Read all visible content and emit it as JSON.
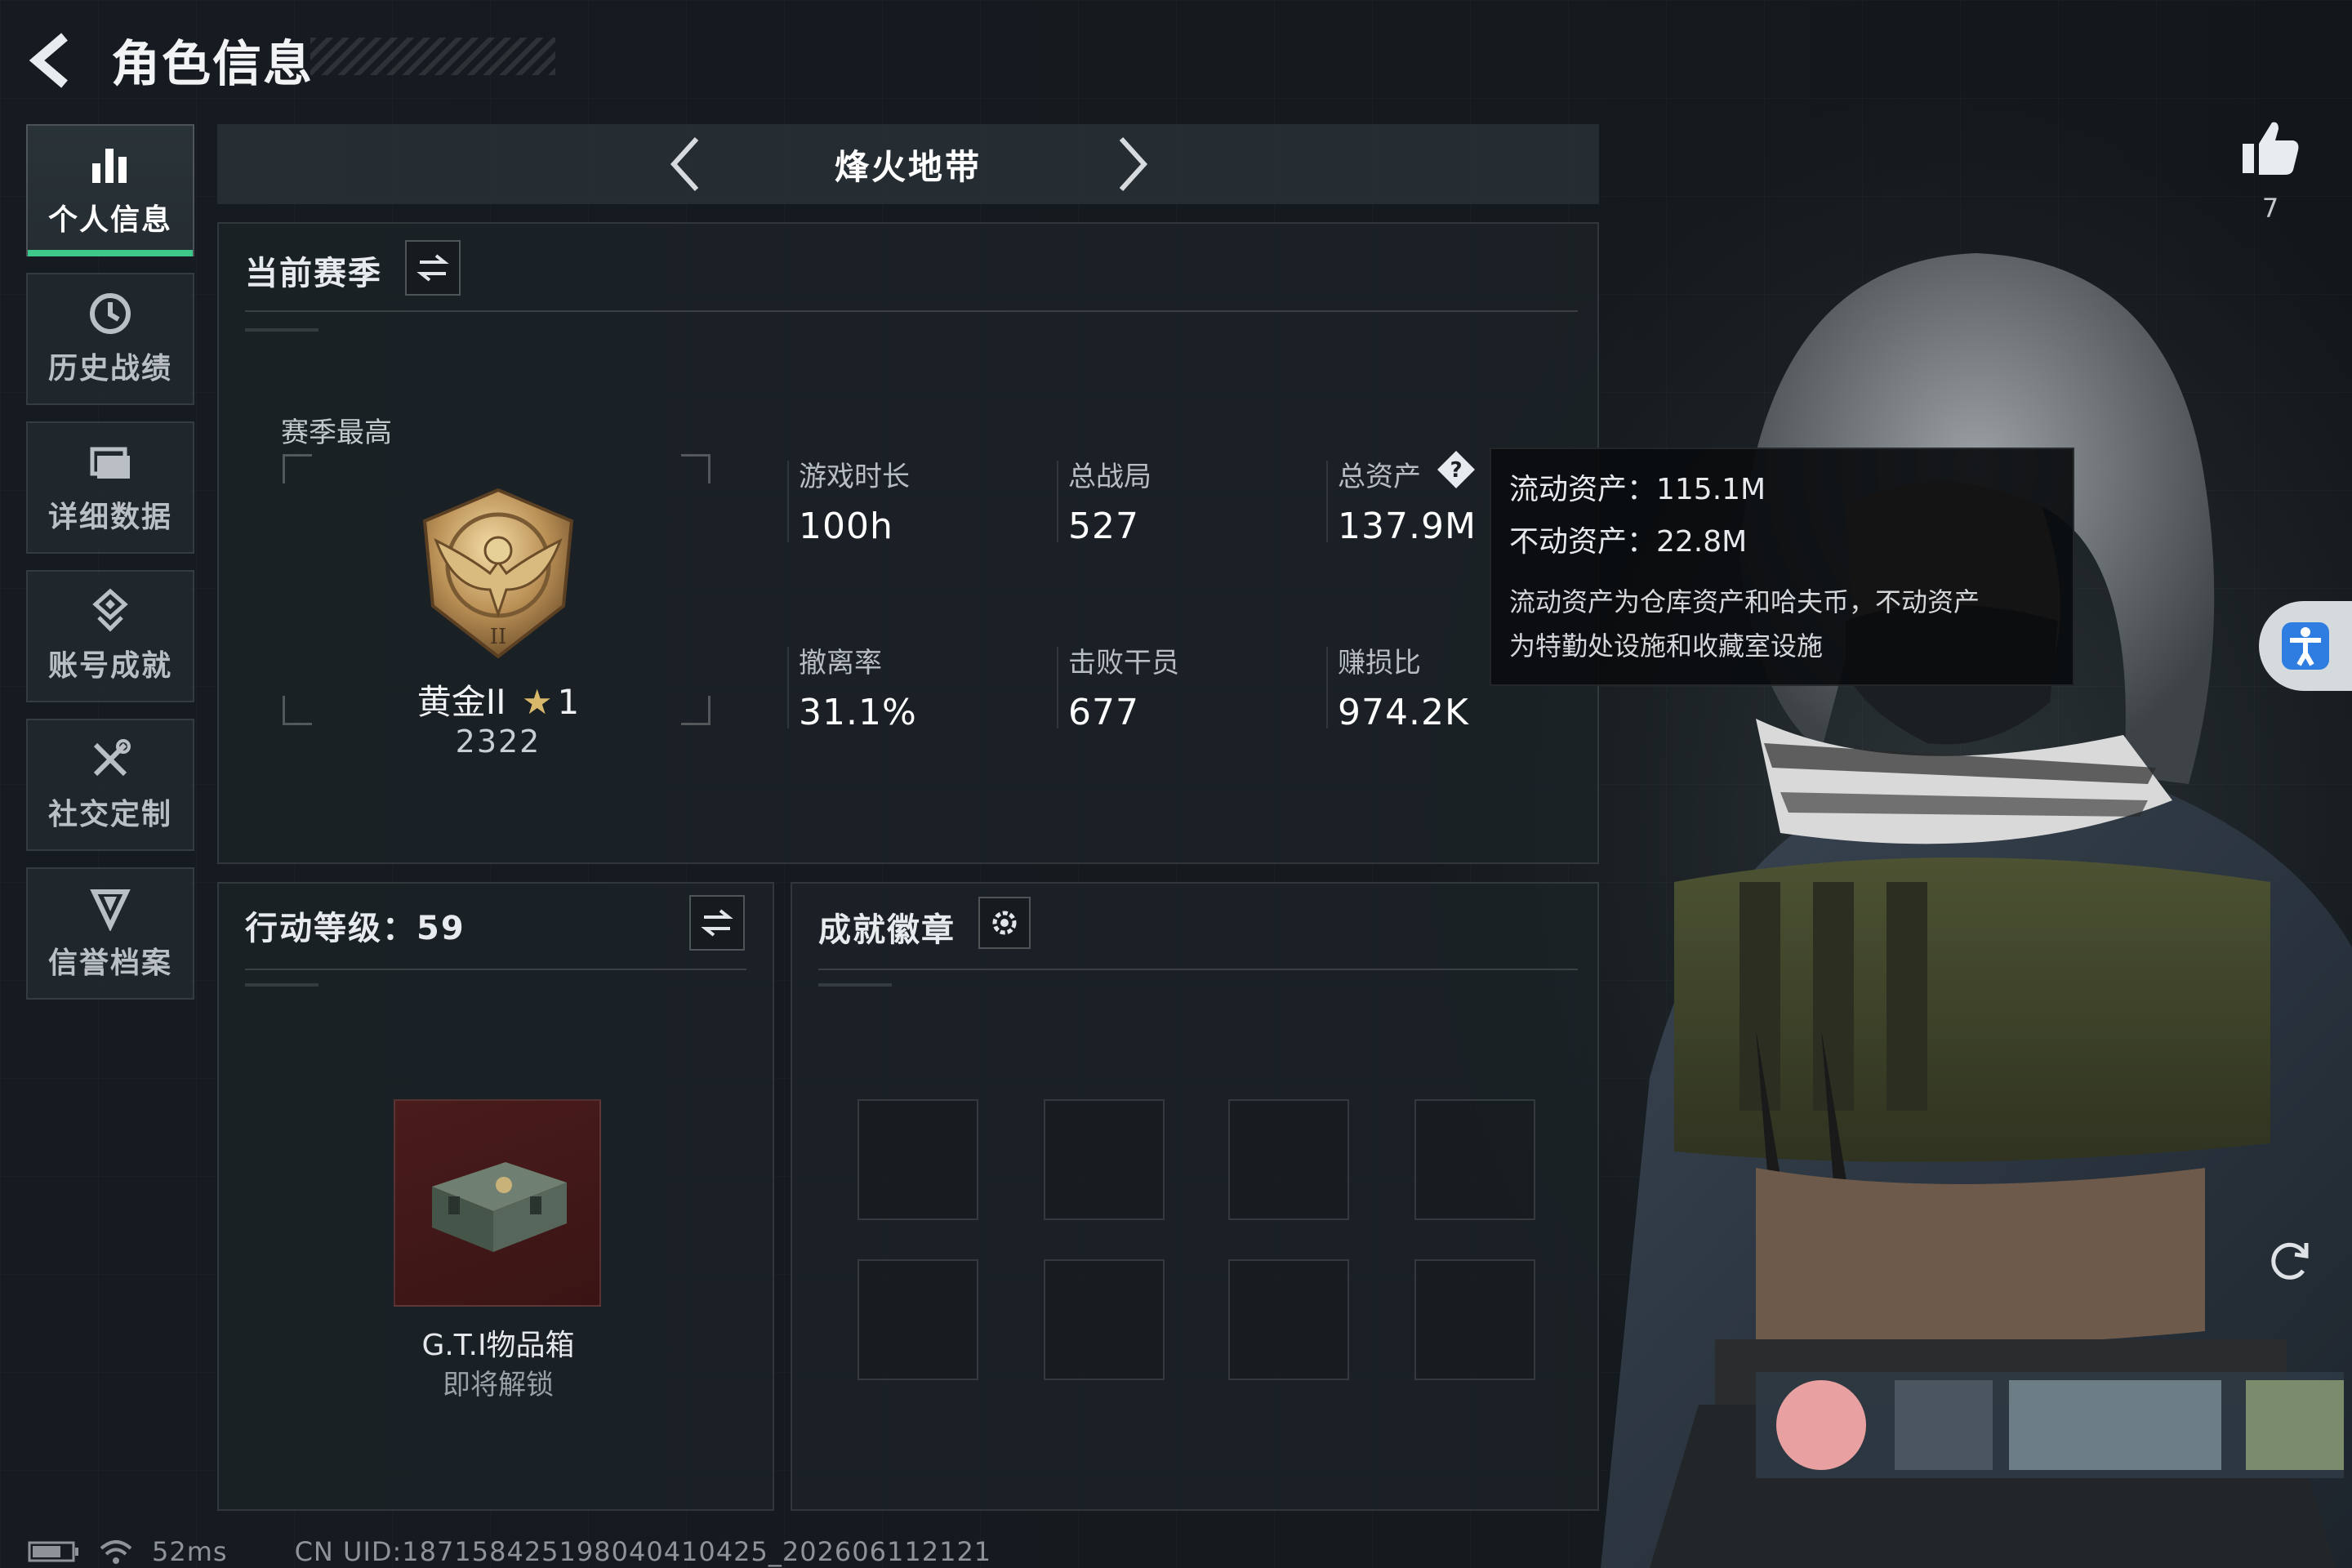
{
  "header": {
    "title": "角色信息"
  },
  "sidebar": {
    "items": [
      {
        "label": "个人信息",
        "icon": "bar-chart-icon",
        "active": true
      },
      {
        "label": "历史战绩",
        "icon": "history-icon",
        "active": false
      },
      {
        "label": "详细数据",
        "icon": "folder-icon",
        "active": false
      },
      {
        "label": "账号成就",
        "icon": "achievement-icon",
        "active": false
      },
      {
        "label": "社交定制",
        "icon": "tools-icon",
        "active": false
      },
      {
        "label": "信誉档案",
        "icon": "shield-icon",
        "active": false
      }
    ]
  },
  "mode": {
    "title": "烽火地带"
  },
  "season": {
    "title": "当前赛季",
    "best_label": "赛季最高",
    "rank_name": "黄金II",
    "rank_stars": "1",
    "rank_score": "2322",
    "stats": [
      {
        "label": "游戏时长",
        "value": "100h"
      },
      {
        "label": "总战局",
        "value": "527"
      },
      {
        "label": "总资产",
        "value": "137.9M"
      },
      {
        "label": "撤离率",
        "value": "31.1%"
      },
      {
        "label": "击败干员",
        "value": "677"
      },
      {
        "label": "赚损比",
        "value": "974.2K"
      }
    ]
  },
  "tooltip": {
    "liquid": "流动资产：115.1M",
    "fixed": "不动资产：22.8M",
    "desc_line1": "流动资产为仓库资产和哈夫币，不动资产",
    "desc_line2": "为特勤处设施和收藏室设施"
  },
  "action_level": {
    "title": "行动等级：59",
    "reward_name": "G.T.I物品箱",
    "reward_status": "即将解锁"
  },
  "badges": {
    "title": "成就徽章",
    "slots": 8
  },
  "likes": {
    "count": "7"
  },
  "status": {
    "ping": "52ms",
    "uid": "CN UID:187158425198040410425_202606112121"
  },
  "colors": {
    "accent": "#3ec98a",
    "panel": "#1c2328",
    "tooltip_bg": "#0a0c0e"
  }
}
